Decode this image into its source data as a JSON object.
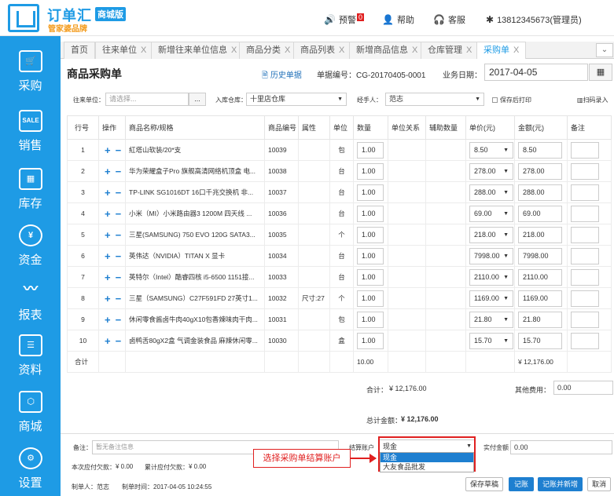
{
  "brand": {
    "name": "订单汇",
    "edition": "商城版",
    "tagline": "管家婆品牌"
  },
  "topbar": {
    "alarm_label": "预警",
    "alarm_count": "0",
    "help_label": "帮助",
    "service_label": "客服",
    "user": "13812345673(管理员)"
  },
  "sidebar": [
    {
      "label": "采购",
      "icon": "cart-icon"
    },
    {
      "label": "销售",
      "icon": "sale-tag-icon"
    },
    {
      "label": "库存",
      "icon": "boxes-icon"
    },
    {
      "label": "资金",
      "icon": "money-bag-icon"
    },
    {
      "label": "报表",
      "icon": "chart-icon"
    },
    {
      "label": "资料",
      "icon": "profile-card-icon"
    },
    {
      "label": "商城",
      "icon": "package-icon"
    },
    {
      "label": "设置",
      "icon": "gear-icon"
    }
  ],
  "tabs": [
    {
      "label": "首页",
      "closable": false
    },
    {
      "label": "往来单位",
      "closable": true
    },
    {
      "label": "新增往来单位信息",
      "closable": true
    },
    {
      "label": "商品分类",
      "closable": true
    },
    {
      "label": "商品列表",
      "closable": true
    },
    {
      "label": "新增商品信息",
      "closable": true
    },
    {
      "label": "仓库管理",
      "closable": true
    },
    {
      "label": "采购单",
      "closable": true,
      "active": true
    }
  ],
  "page": {
    "title": "商品采购单",
    "history_link": "历史单据",
    "doc_no": "单据编号：CG-20170405-0001",
    "date_label": "业务日期：",
    "date_value": "2017-04-05"
  },
  "filters": {
    "supplier_label": "往来单位：",
    "supplier_placeholder": "请选择...",
    "supplier_btn": "...",
    "warehouse_label": "入库仓库：",
    "warehouse_value": "十里店仓库",
    "handler_label": "经手人：",
    "handler_value": "范志",
    "print_after_save": "保存后打印",
    "scan_entry": "扫码录入"
  },
  "grid": {
    "headers": [
      "行号",
      "操作",
      "商品名称/规格",
      "商品编号",
      "属性",
      "单位",
      "数量",
      "单位关系",
      "辅助数量",
      "单价(元)",
      "金额(元)",
      "备注"
    ],
    "rows": [
      {
        "no": "1",
        "name": "紅塔山软装/20*支",
        "code": "10039",
        "attr": "",
        "unit": "包",
        "qty": "1.00",
        "price": "8.50",
        "amount": "8.50"
      },
      {
        "no": "2",
        "name": "华为荣耀盒子Pro 旗舰高清网络机顶盒 电...",
        "code": "10038",
        "attr": "",
        "unit": "台",
        "qty": "1.00",
        "price": "278.00",
        "amount": "278.00"
      },
      {
        "no": "3",
        "name": "TP-LINK SG1016DT 16口千兆交换机 非...",
        "code": "10037",
        "attr": "",
        "unit": "台",
        "qty": "1.00",
        "price": "288.00",
        "amount": "288.00"
      },
      {
        "no": "4",
        "name": "小米（MI）小米路由器3 1200M 四天线 ...",
        "code": "10036",
        "attr": "",
        "unit": "台",
        "qty": "1.00",
        "price": "69.00",
        "amount": "69.00"
      },
      {
        "no": "5",
        "name": "三星(SAMSUNG) 750 EVO 120G SATA3...",
        "code": "10035",
        "attr": "",
        "unit": "个",
        "qty": "1.00",
        "price": "218.00",
        "amount": "218.00"
      },
      {
        "no": "6",
        "name": "英伟达（NVIDIA）TITAN X 显卡",
        "code": "10034",
        "attr": "",
        "unit": "台",
        "qty": "1.00",
        "price": "7998.00",
        "amount": "7998.00"
      },
      {
        "no": "7",
        "name": "英特尔（Intel）酷睿四核 i5-6500 1151接...",
        "code": "10033",
        "attr": "",
        "unit": "台",
        "qty": "1.00",
        "price": "2110.00",
        "amount": "2110.00"
      },
      {
        "no": "8",
        "name": "三星（SAMSUNG）C27F591FD 27英寸1...",
        "code": "10032",
        "attr": "尺寸:27",
        "unit": "个",
        "qty": "1.00",
        "price": "1169.00",
        "amount": "1169.00"
      },
      {
        "no": "9",
        "name": "休闲零食酱卤牛肉40gX10包香辣味肉干肉...",
        "code": "10031",
        "attr": "",
        "unit": "包",
        "qty": "1.00",
        "price": "21.80",
        "amount": "21.80"
      },
      {
        "no": "10",
        "name": "卤鸭舌80gX2盒 气调金装食品 麻辣休闲零...",
        "code": "10030",
        "attr": "",
        "unit": "盒",
        "qty": "1.00",
        "price": "15.70",
        "amount": "15.70"
      }
    ],
    "total_label": "合计",
    "total_qty": "10.00",
    "total_amount": "¥ 12,176.00",
    "add_symbol": "+",
    "remove_symbol": "−"
  },
  "summary": {
    "subtotal_label": "合计：",
    "subtotal_value": "¥ 12,176.00",
    "other_fee_label": "其他费用：",
    "other_fee_value": "0.00",
    "grand_label": "总计金额：",
    "grand_value": "¥ 12,176.00"
  },
  "bottom": {
    "remark_label": "备注：",
    "remark_placeholder": "暂无备注信息",
    "account_label": "结算账户",
    "account_value": "现金",
    "account_options": [
      "现金",
      "大友食品批发"
    ],
    "paid_label": "实付金额",
    "paid_value": "0.00",
    "owe_label": "本次应付欠款：",
    "owe_value": "¥ 0.00",
    "total_owe_label": "累计应付欠款：",
    "total_owe_value": "¥ 0.00",
    "creator": "制单人：范志",
    "created_at": "制单时间：2017-04-05 10:24:55",
    "callout": "选择采购单结算账户",
    "btn_draft": "保存草稿",
    "btn_post": "记账",
    "btn_post_new": "记账并新增",
    "btn_cancel": "取消"
  },
  "colors": {
    "accent": "#1e9be5",
    "brand_orange": "#f39a1a",
    "alert": "#e02020"
  }
}
